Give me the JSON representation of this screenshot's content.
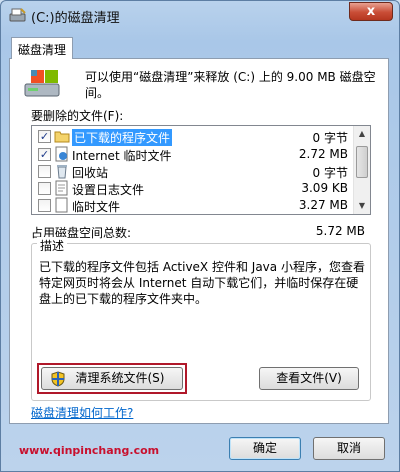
{
  "window": {
    "title": "(C:)的磁盘清理",
    "close_label": "x"
  },
  "tab": {
    "label": "磁盘清理"
  },
  "intro": {
    "text": "可以使用“磁盘清理”来释放 (C:) 上的 9.00 MB 磁盘空间。"
  },
  "files": {
    "label": "要删除的文件(F):",
    "rows": [
      {
        "name": "已下载的程序文件",
        "size": "0 字节",
        "checked": true,
        "selected": true,
        "icon": "folder-icon"
      },
      {
        "name": "Internet 临时文件",
        "size": "2.72 MB",
        "checked": true,
        "selected": false,
        "icon": "internet-file-icon"
      },
      {
        "name": "回收站",
        "size": "0 字节",
        "checked": false,
        "selected": false,
        "icon": "recycle-bin-icon"
      },
      {
        "name": "设置日志文件",
        "size": "3.09 KB",
        "checked": false,
        "selected": false,
        "icon": "log-file-icon"
      },
      {
        "name": "临时文件",
        "size": "3.27 MB",
        "checked": false,
        "selected": false,
        "icon": "temp-file-icon"
      }
    ]
  },
  "total": {
    "label": "占用磁盘空间总数:",
    "value": "5.72 MB"
  },
  "description": {
    "title": "描述",
    "text": "已下载的程序文件包括 ActiveX 控件和 Java 小程序，您查看特定网页时将会从 Internet 自动下载它们，并临时保存在硬盘上的已下载的程序文件夹中。"
  },
  "buttons": {
    "cleanup_system": "清理系统文件(S)",
    "view_files": "查看文件(V)",
    "ok": "确定",
    "cancel": "取消"
  },
  "help_link": "磁盘清理如何工作?",
  "watermark": "www.qinpinchang.com",
  "colors": {
    "highlight": "#3399ff",
    "frame": "#b0182a",
    "link": "#0066cc",
    "watermark": "#c8102e"
  }
}
